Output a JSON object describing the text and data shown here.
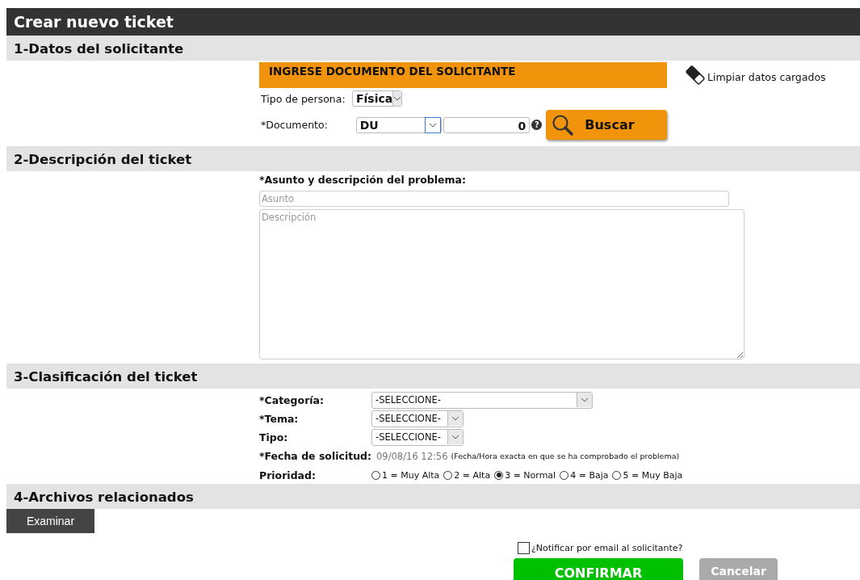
{
  "window": {
    "title": "Crear nuevo ticket"
  },
  "sections": [
    {
      "title": "1-Datos del solicitante"
    },
    {
      "title": "2-Descripción del ticket"
    },
    {
      "title": "3-Clasificación del ticket"
    },
    {
      "title": "4-Archivos relacionados"
    }
  ],
  "solicitante": {
    "banner": "INGRESE DOCUMENTO DEL SOLICITANTE",
    "clear_link": "Limpiar datos cargados",
    "tipo_label": "Tipo de persona:",
    "tipo_value": "Física",
    "documento_label": "*Documento:",
    "documento_type": "DU",
    "documento_number": "0",
    "help": "?",
    "search_button": "Buscar"
  },
  "descripcion": {
    "label": "*Asunto y descripción del problema:",
    "asunto_placeholder": "Asunto",
    "descripcion_placeholder": "Descripción"
  },
  "clasificacion": {
    "categoria_label": "*Categoría:",
    "categoria_value": "-SELECCIONE-",
    "tema_label": "*Tema:",
    "tema_value": "-SELECCIONE-",
    "tipo_label": "Tipo:",
    "tipo_value": "-SELECCIONE-",
    "fecha_label": "*Fecha de solicitud:",
    "fecha_value": "09/08/16 12:56",
    "fecha_note": "(Fecha/Hora exacta en que se ha comprobado el problema)",
    "prioridad_label": "Prioridad:",
    "prioridades": [
      {
        "label": "1 = Muy Alta",
        "selected": false
      },
      {
        "label": "2 = Alta",
        "selected": false
      },
      {
        "label": "3 = Normal",
        "selected": true
      },
      {
        "label": "4 = Baja",
        "selected": false
      },
      {
        "label": "5 = Muy Baja",
        "selected": false
      }
    ]
  },
  "archivos": {
    "browse_button": "Examinar"
  },
  "footer": {
    "notify_label": "¿Notificar por email al solicitante?",
    "notify_checked": false,
    "confirm_button": "CONFIRMAR",
    "cancel_button": "Cancelar"
  }
}
